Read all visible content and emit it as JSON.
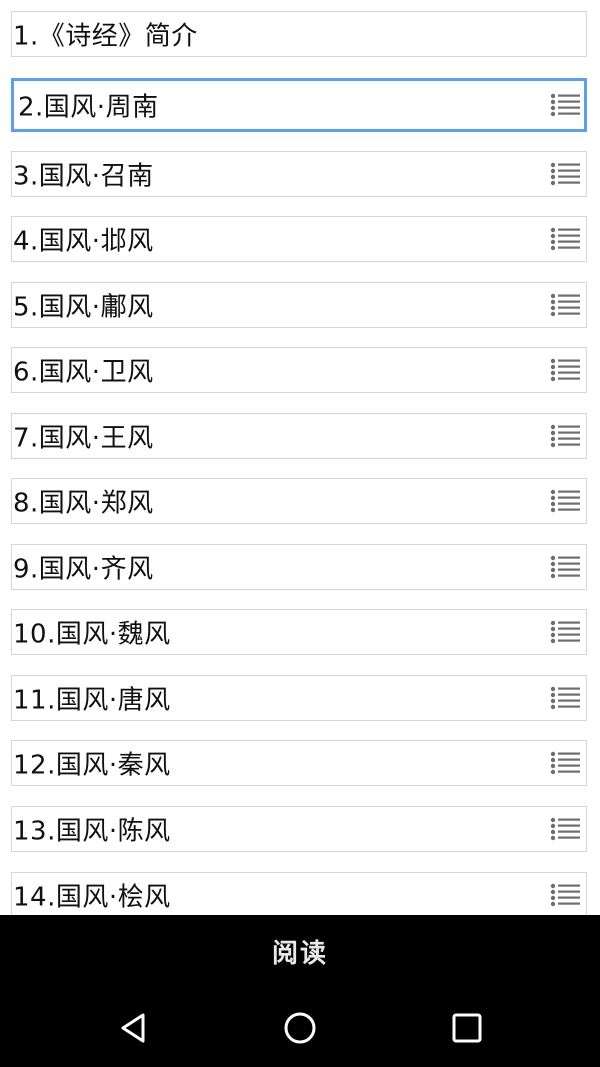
{
  "list": {
    "items": [
      {
        "label": "1.《诗经》简介",
        "has_menu": false,
        "selected": false
      },
      {
        "label": "2.国风·周南",
        "has_menu": true,
        "selected": true
      },
      {
        "label": "3.国风·召南",
        "has_menu": true,
        "selected": false
      },
      {
        "label": "4.国风·邶风",
        "has_menu": true,
        "selected": false
      },
      {
        "label": "5.国风·鄘风",
        "has_menu": true,
        "selected": false
      },
      {
        "label": "6.国风·卫风",
        "has_menu": true,
        "selected": false
      },
      {
        "label": "7.国风·王风",
        "has_menu": true,
        "selected": false
      },
      {
        "label": "8.国风·郑风",
        "has_menu": true,
        "selected": false
      },
      {
        "label": "9.国风·齐风",
        "has_menu": true,
        "selected": false
      },
      {
        "label": "10.国风·魏风",
        "has_menu": true,
        "selected": false
      },
      {
        "label": "11.国风·唐风",
        "has_menu": true,
        "selected": false
      },
      {
        "label": "12.国风·秦风",
        "has_menu": true,
        "selected": false
      },
      {
        "label": "13.国风·陈风",
        "has_menu": true,
        "selected": false
      },
      {
        "label": "14.国风·桧风",
        "has_menu": true,
        "selected": false
      }
    ]
  },
  "read_bar": {
    "label": "阅读"
  },
  "nav_bar": {
    "buttons": [
      {
        "name": "back-icon"
      },
      {
        "name": "home-icon"
      },
      {
        "name": "recents-icon"
      }
    ]
  },
  "colors": {
    "selected_border": "#5aa0f2",
    "item_border": "#d6d6d6",
    "bar_background": "#000000"
  }
}
